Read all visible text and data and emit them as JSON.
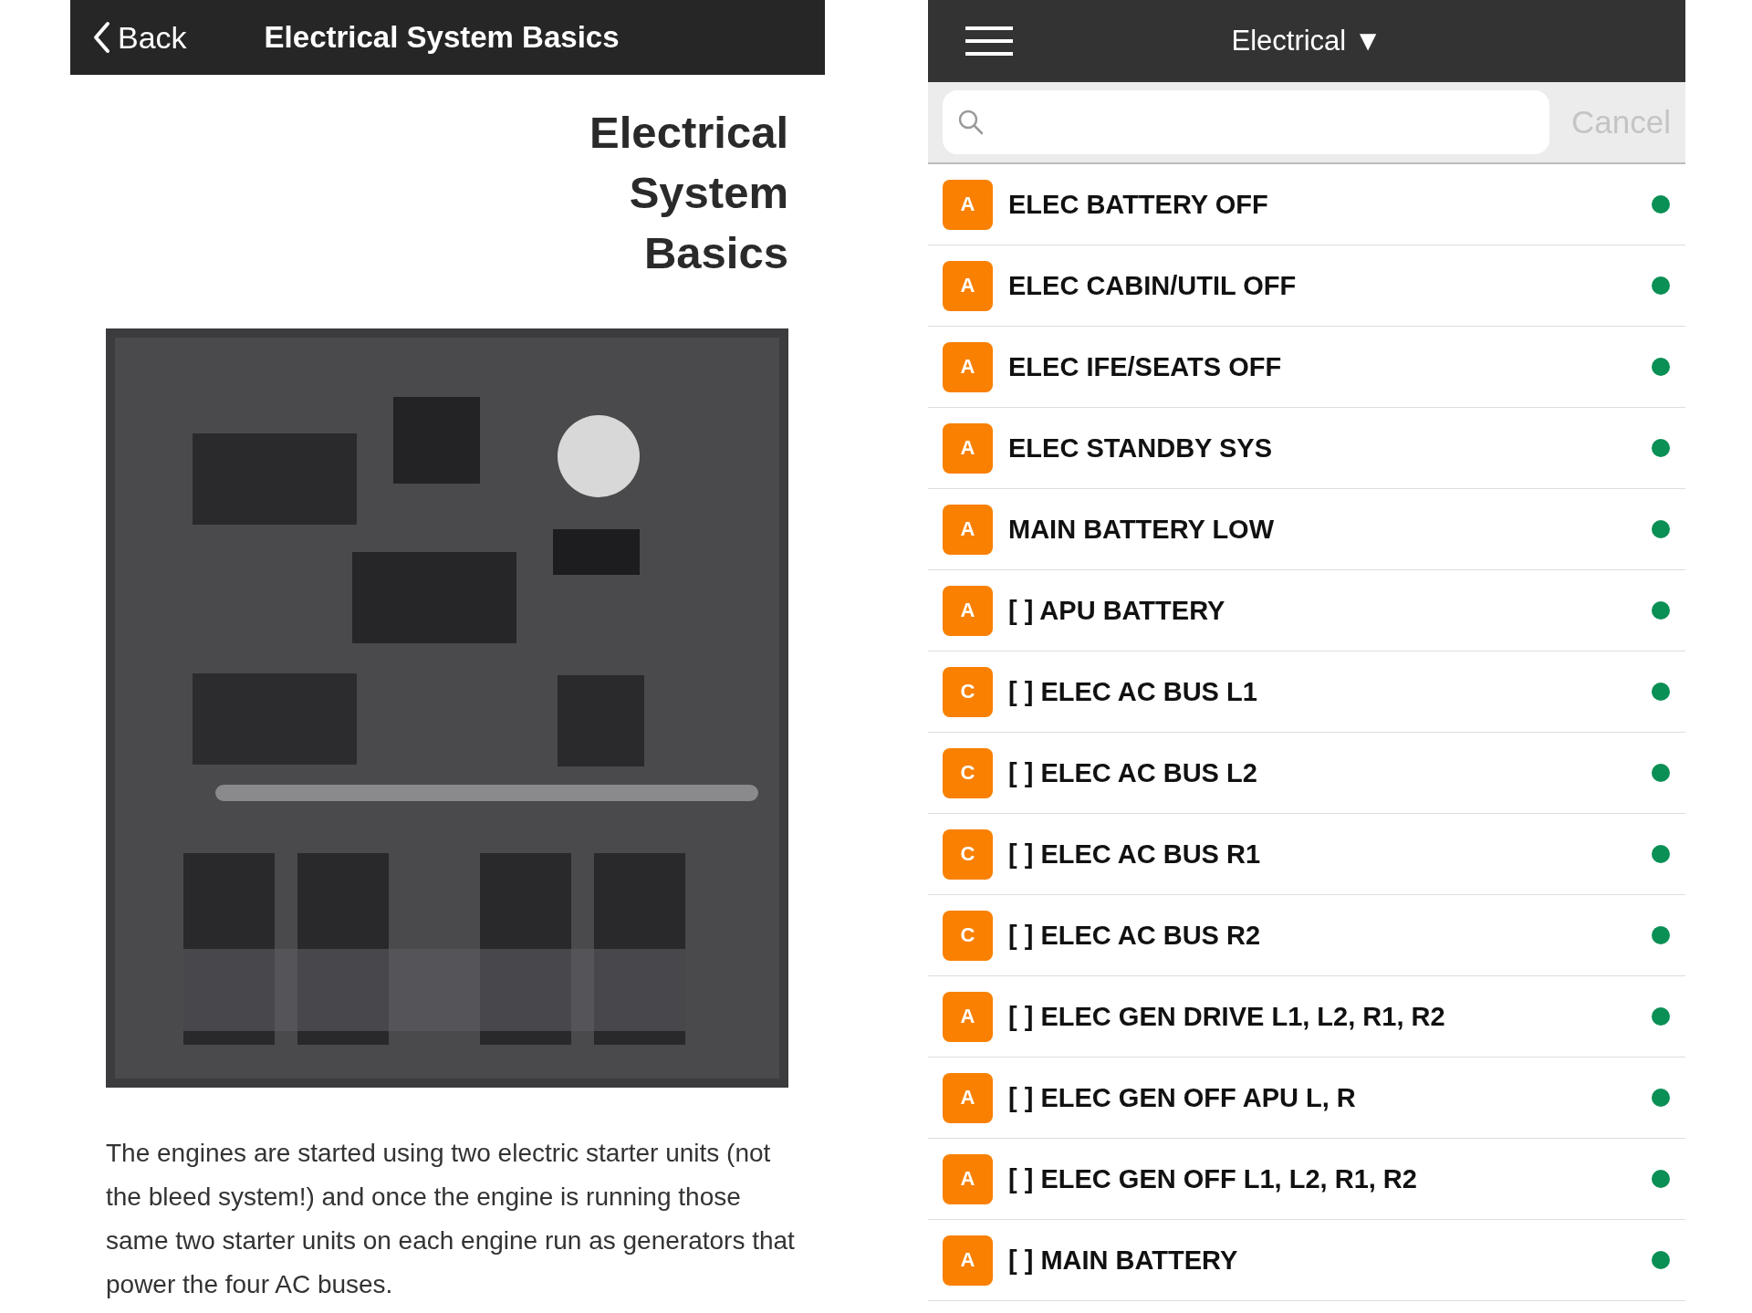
{
  "article": {
    "nav": {
      "back": "Back",
      "title": "Electrical System Basics"
    },
    "heading": [
      "Electrical",
      "System",
      "Basics"
    ],
    "paragraph": "The engines are started using two electric starter units (not the bleed system!) and once the engine is running those same two starter units on each engine run as generators that power the four AC buses."
  },
  "checklist": {
    "header": {
      "title": "Electrical ▼"
    },
    "search": {
      "cancel": "Cancel"
    },
    "items": [
      {
        "badge": "A",
        "label": "ELEC BATTERY OFF"
      },
      {
        "badge": "A",
        "label": "ELEC CABIN/UTIL OFF"
      },
      {
        "badge": "A",
        "label": "ELEC IFE/SEATS OFF"
      },
      {
        "badge": "A",
        "label": "ELEC STANDBY SYS"
      },
      {
        "badge": "A",
        "label": "MAIN BATTERY LOW"
      },
      {
        "badge": "A",
        "label": "[ ] APU BATTERY"
      },
      {
        "badge": "C",
        "label": "[ ] ELEC AC BUS L1"
      },
      {
        "badge": "C",
        "label": "[ ] ELEC AC BUS L2"
      },
      {
        "badge": "C",
        "label": "[ ] ELEC AC BUS R1"
      },
      {
        "badge": "C",
        "label": "[ ] ELEC AC BUS R2"
      },
      {
        "badge": "A",
        "label": "[ ] ELEC GEN DRIVE L1, L2, R1, R2"
      },
      {
        "badge": "A",
        "label": "[ ] ELEC GEN OFF APU L, R"
      },
      {
        "badge": "A",
        "label": "[ ] ELEC GEN OFF L1, L2, R1, R2"
      },
      {
        "badge": "A",
        "label": "[ ] MAIN BATTERY"
      }
    ]
  }
}
